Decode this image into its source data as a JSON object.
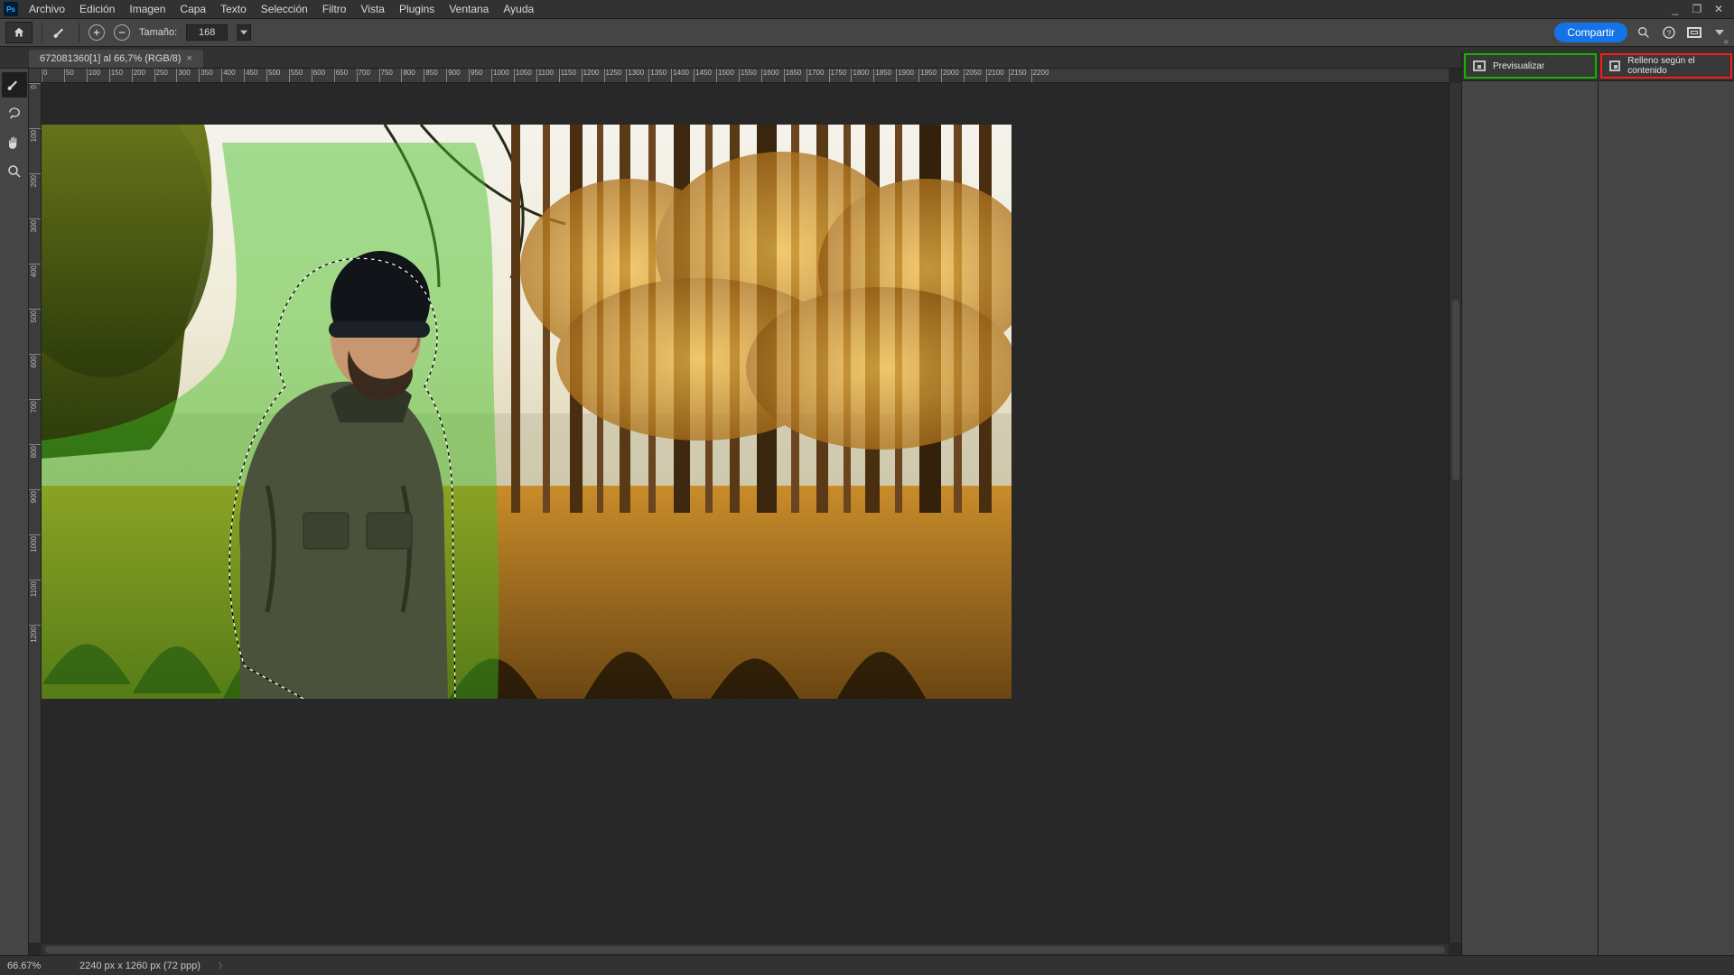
{
  "app": {
    "logo_text": "Ps"
  },
  "menu": [
    "Archivo",
    "Edición",
    "Imagen",
    "Capa",
    "Texto",
    "Selección",
    "Filtro",
    "Vista",
    "Plugins",
    "Ventana",
    "Ayuda"
  ],
  "window_controls": {
    "min": "_",
    "restore": "❐",
    "close": "✕"
  },
  "options": {
    "size_label": "Tamaño:",
    "size_value": "168",
    "share_label": "Compartir"
  },
  "document": {
    "tab_title": "672081360[1] al 66,7% (RGB/8)",
    "close": "×"
  },
  "ruler_marks_h": [
    "0",
    "50",
    "100",
    "150",
    "200",
    "250",
    "300",
    "350",
    "400",
    "450",
    "500",
    "550",
    "600",
    "650",
    "700",
    "750",
    "800",
    "850",
    "900",
    "950",
    "1000",
    "1050",
    "1100",
    "1150",
    "1200",
    "1250",
    "1300",
    "1350",
    "1400",
    "1450",
    "1500",
    "1550",
    "1600",
    "1650",
    "1700",
    "1750",
    "1800",
    "1850",
    "1900",
    "1950",
    "2000",
    "2050",
    "2100",
    "2150",
    "2200"
  ],
  "ruler_marks_v": [
    "0",
    "100",
    "200",
    "300",
    "400",
    "500",
    "600",
    "700",
    "800",
    "900",
    "1000",
    "1100",
    "1200"
  ],
  "panels": {
    "left_tab": "Previsualizar",
    "right_tab": "Relleno según el contenido"
  },
  "status": {
    "zoom": "66.67%",
    "doc_info": "2240 px x 1260 px (72 ppp)"
  }
}
